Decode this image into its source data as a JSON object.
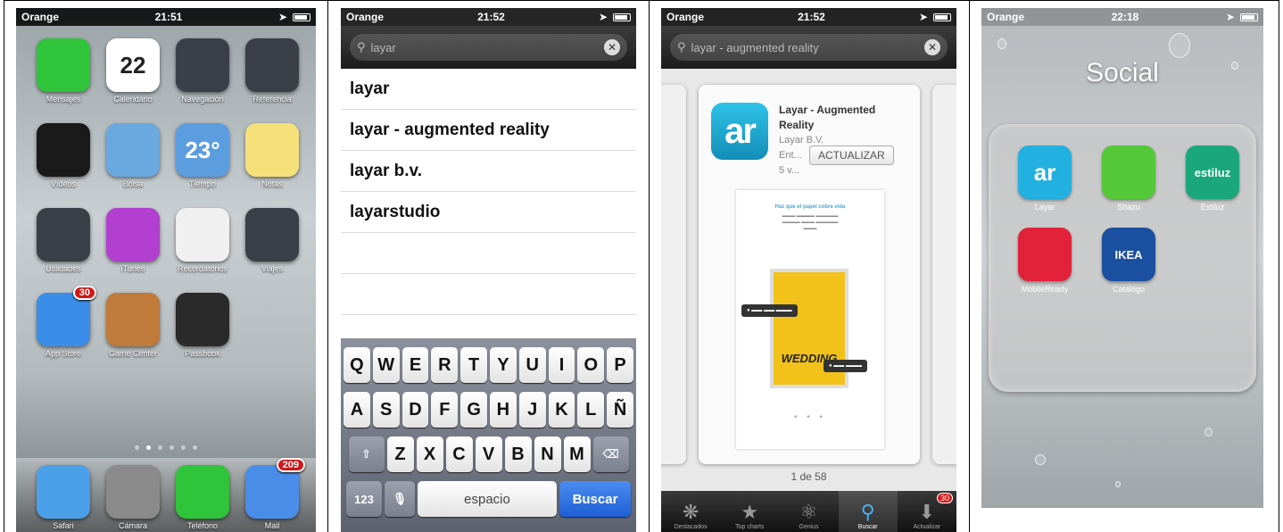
{
  "panel1": {
    "status": {
      "carrier": "Orange",
      "time": "21:51"
    },
    "apps": [
      {
        "label": "Mensajes",
        "icon": "message-icon",
        "color": "#2fc43a"
      },
      {
        "label": "Calendario",
        "icon": "calendar-icon",
        "color": "#ffffff",
        "glyph": "22"
      },
      {
        "label": "Navegación",
        "icon": "folder-icon",
        "color": "#3a3f48"
      },
      {
        "label": "Referencia",
        "icon": "folder-icon",
        "color": "#3a3f48"
      },
      {
        "label": "Vídeos",
        "icon": "clapperboard-icon",
        "color": "#1a1a1a"
      },
      {
        "label": "Bolsa",
        "icon": "stocks-icon",
        "color": "#6aa8e0"
      },
      {
        "label": "Tiempo",
        "icon": "weather-icon",
        "color": "#5c9de0",
        "glyph": "23°"
      },
      {
        "label": "Notas",
        "icon": "notes-icon",
        "color": "#f5e07a"
      },
      {
        "label": "Utilidades",
        "icon": "folder-icon",
        "color": "#3a3f48"
      },
      {
        "label": "iTunes",
        "icon": "music-icon",
        "color": "#b23fd0"
      },
      {
        "label": "Recordatorios",
        "icon": "reminders-icon",
        "color": "#f0f0f0"
      },
      {
        "label": "Viajes",
        "icon": "folder-icon",
        "color": "#3a3f48"
      },
      {
        "label": "App Store",
        "icon": "appstore-icon",
        "color": "#3a8de8",
        "badge": "30"
      },
      {
        "label": "Game Center",
        "icon": "gamecenter-icon",
        "color": "#c07a3a"
      },
      {
        "label": "Passbook",
        "icon": "passbook-icon",
        "color": "#2a2a2a"
      }
    ],
    "dock": [
      {
        "label": "Safari",
        "icon": "safari-icon",
        "color": "#4aa0e8"
      },
      {
        "label": "Cámara",
        "icon": "camera-icon",
        "color": "#8a8a8a"
      },
      {
        "label": "Teléfono",
        "icon": "phone-icon",
        "color": "#2fc43a"
      },
      {
        "label": "Mail",
        "icon": "mail-icon",
        "color": "#4a8de8",
        "badge": "209"
      }
    ]
  },
  "panel2": {
    "status": {
      "carrier": "Orange",
      "time": "21:52"
    },
    "query": "layar",
    "results": [
      "layar",
      "layar - augmented reality",
      "layar b.v.",
      "layarstudio"
    ],
    "keyboard": {
      "row1": [
        "Q",
        "W",
        "E",
        "R",
        "T",
        "Y",
        "U",
        "I",
        "O",
        "P"
      ],
      "row2": [
        "A",
        "S",
        "D",
        "F",
        "G",
        "H",
        "J",
        "K",
        "L",
        "Ñ"
      ],
      "row3": [
        "Z",
        "X",
        "C",
        "V",
        "B",
        "N",
        "M"
      ],
      "numbers": "123",
      "space": "espacio",
      "go": "Buscar"
    }
  },
  "panel3": {
    "status": {
      "carrier": "Orange",
      "time": "21:52"
    },
    "query": "layar - augmented reality",
    "app": {
      "title_line1": "Layar - Augmented",
      "title_line2": "Reality",
      "developer": "Layar B.V.",
      "category": "Ent...",
      "rating": "5 v...",
      "button": "ACTUALIZAR",
      "icon_text": "ar"
    },
    "screenshot": {
      "caption": "Haz que el papel cobre vida",
      "poster_word": "WEDDING"
    },
    "pager": "1 de 58",
    "tabs": [
      {
        "label": "Destacados",
        "icon": "featured-icon"
      },
      {
        "label": "Top charts",
        "icon": "star-icon"
      },
      {
        "label": "Genius",
        "icon": "genius-icon"
      },
      {
        "label": "Buscar",
        "icon": "search-icon",
        "active": true
      },
      {
        "label": "Actualizar",
        "icon": "update-icon",
        "badge": "30"
      }
    ]
  },
  "panel4": {
    "status": {
      "carrier": "Orange",
      "time": "22:18"
    },
    "folder_title": "Social",
    "apps": [
      {
        "label": "Layar",
        "icon": "layar-icon",
        "color": "#22b0e0",
        "glyph": "ar"
      },
      {
        "label": "Shazu",
        "icon": "shazu-icon",
        "color": "#55c83a"
      },
      {
        "label": "Estiluz",
        "icon": "estiluz-icon",
        "color": "#1aa87a",
        "glyph": "estiluz"
      },
      {
        "label": "MobileReady",
        "icon": "mobileready-icon",
        "color": "#e2213a"
      },
      {
        "label": "Catalogo",
        "icon": "ikea-catalog-icon",
        "color": "#1b4fa0",
        "glyph": "IKEA"
      }
    ]
  }
}
